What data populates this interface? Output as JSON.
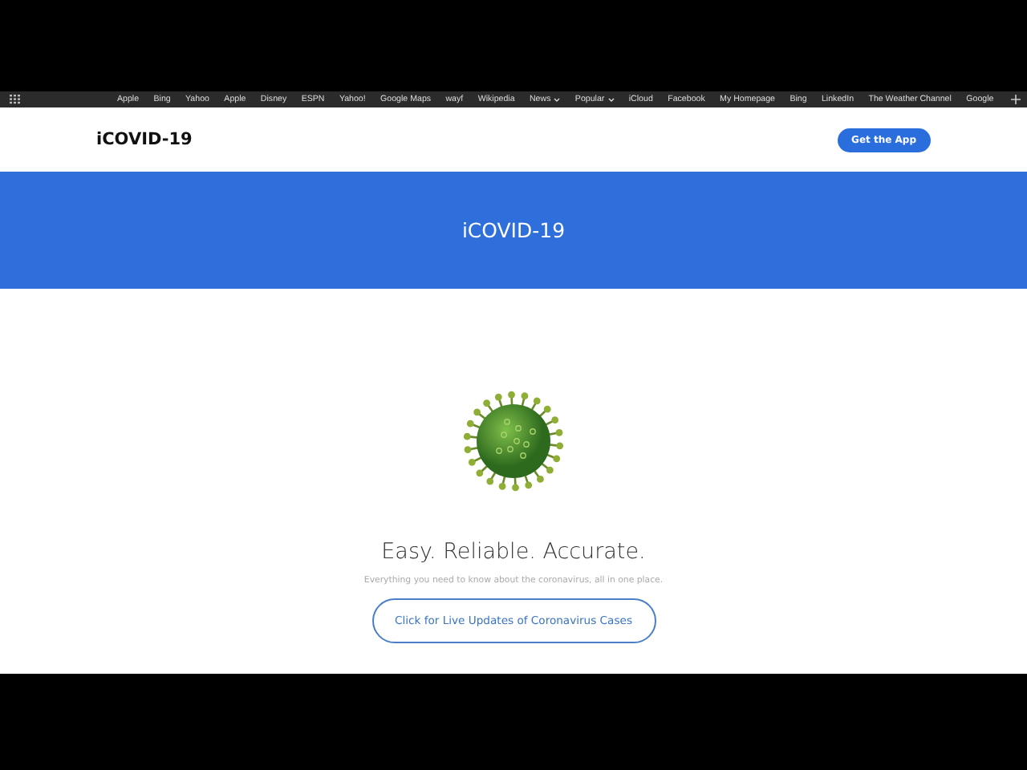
{
  "bookmarks": [
    {
      "label": "Apple",
      "kind": "link"
    },
    {
      "label": "Bing",
      "kind": "link"
    },
    {
      "label": "Yahoo",
      "kind": "link"
    },
    {
      "label": "Apple",
      "kind": "link"
    },
    {
      "label": "Disney",
      "kind": "link"
    },
    {
      "label": "ESPN",
      "kind": "link"
    },
    {
      "label": "Yahoo!",
      "kind": "link"
    },
    {
      "label": "Google Maps",
      "kind": "link"
    },
    {
      "label": "wayf",
      "kind": "link"
    },
    {
      "label": "Wikipedia",
      "kind": "link"
    },
    {
      "label": "News",
      "kind": "folder"
    },
    {
      "label": "Popular",
      "kind": "folder"
    },
    {
      "label": "iCloud",
      "kind": "link"
    },
    {
      "label": "Facebook",
      "kind": "link"
    },
    {
      "label": "My Homepage",
      "kind": "link"
    },
    {
      "label": "Bing",
      "kind": "link"
    },
    {
      "label": "LinkedIn",
      "kind": "link"
    },
    {
      "label": "The Weather Channel",
      "kind": "link"
    },
    {
      "label": "Google",
      "kind": "link"
    }
  ],
  "header": {
    "logo": "iCOVID-19",
    "button": "Get the App"
  },
  "banner": {
    "title": "iCOVID-19"
  },
  "hero": {
    "heading": "Easy. Reliable. Accurate.",
    "subtitle": "Everything you need to know about the coronavirus, all in one place.",
    "button": "Click for Live Updates of Coronavirus Cases"
  }
}
